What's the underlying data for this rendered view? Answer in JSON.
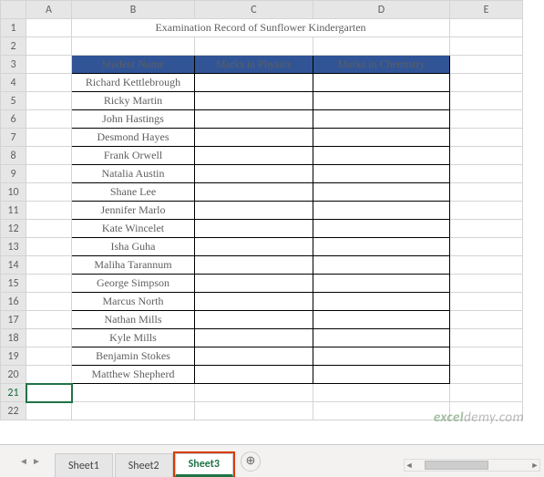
{
  "columns": [
    "A",
    "B",
    "C",
    "D",
    "E"
  ],
  "title": "Examination Record of Sunflower Kindergarten",
  "headers": {
    "name": "Student Name",
    "physics": "Marks in Physics",
    "chemistry": "Marks in Chemistry"
  },
  "students": [
    "Richard Kettlebrough",
    "Ricky Martin",
    "John Hastings",
    "Desmond Hayes",
    "Frank Orwell",
    "Natalia Austin",
    "Shane Lee",
    "Jennifer Marlo",
    "Kate Wincelet",
    "Isha Guha",
    "Maliha Tarannum",
    "George Simpson",
    "Marcus North",
    "Nathan Mills",
    "Kyle Mills",
    "Benjamin Stokes",
    "Matthew Shepherd"
  ],
  "selected_row": 21,
  "tabs": [
    "Sheet1",
    "Sheet2",
    "Sheet3"
  ],
  "active_tab": "Sheet3",
  "add_tab_icon": "⊕",
  "nav_icons": {
    "prev": "◄",
    "next": "►"
  },
  "watermark": {
    "pre": "",
    "brand1": "excel",
    "brand2": "demy",
    "suffix": ".com"
  },
  "chart_data": {
    "type": "table",
    "title": "Examination Record of Sunflower Kindergarten",
    "columns": [
      "Student Name",
      "Marks in Physics",
      "Marks in Chemistry"
    ],
    "rows": [
      [
        "Richard Kettlebrough",
        null,
        null
      ],
      [
        "Ricky Martin",
        null,
        null
      ],
      [
        "John Hastings",
        null,
        null
      ],
      [
        "Desmond Hayes",
        null,
        null
      ],
      [
        "Frank Orwell",
        null,
        null
      ],
      [
        "Natalia Austin",
        null,
        null
      ],
      [
        "Shane Lee",
        null,
        null
      ],
      [
        "Jennifer Marlo",
        null,
        null
      ],
      [
        "Kate Wincelet",
        null,
        null
      ],
      [
        "Isha Guha",
        null,
        null
      ],
      [
        "Maliha Tarannum",
        null,
        null
      ],
      [
        "George Simpson",
        null,
        null
      ],
      [
        "Marcus North",
        null,
        null
      ],
      [
        "Nathan Mills",
        null,
        null
      ],
      [
        "Kyle Mills",
        null,
        null
      ],
      [
        "Benjamin Stokes",
        null,
        null
      ],
      [
        "Matthew Shepherd",
        null,
        null
      ]
    ]
  }
}
